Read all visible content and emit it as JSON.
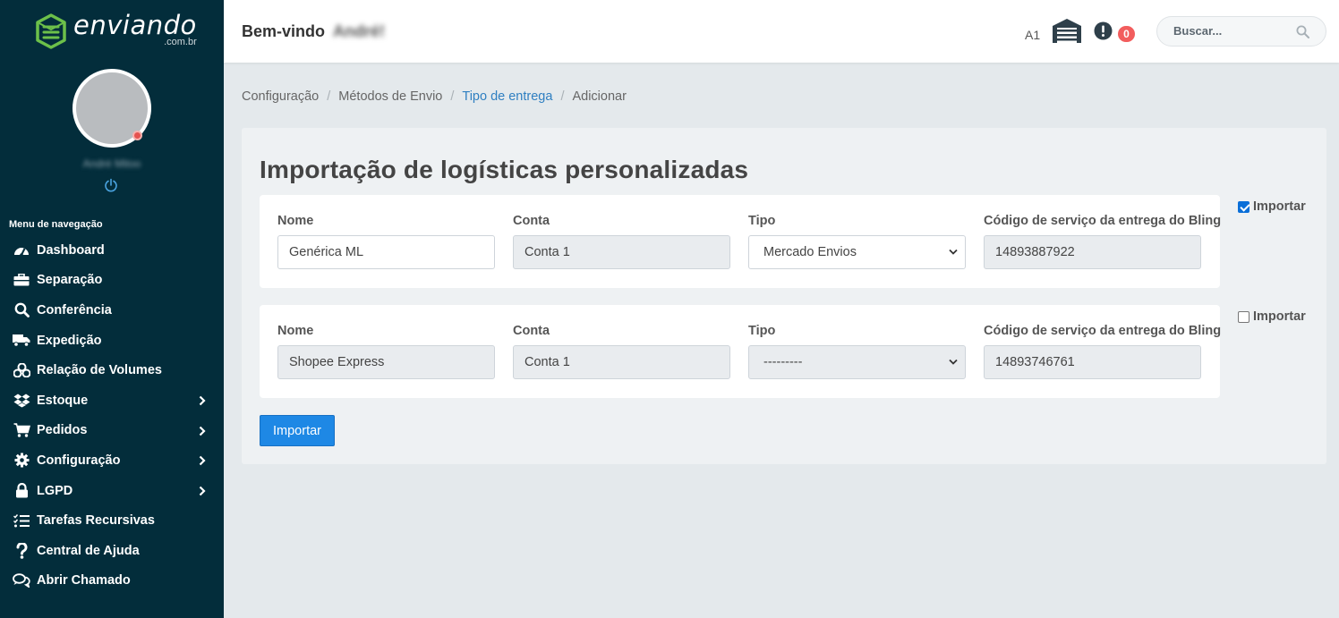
{
  "sidebar": {
    "logo": {
      "word": "enviando",
      "sub": ".com.br",
      "color": "#6cc04a"
    },
    "user_name": "André Mitoo",
    "menu_title": "Menu de navegação",
    "items": [
      {
        "label": "Dashboard",
        "icon": "tachometer-icon",
        "submenu": false
      },
      {
        "label": "Separação",
        "icon": "toolbox-icon",
        "submenu": false
      },
      {
        "label": "Conferência",
        "icon": "search-icon",
        "submenu": false
      },
      {
        "label": "Expedição",
        "icon": "truck-icon",
        "submenu": false
      },
      {
        "label": "Relação de Volumes",
        "icon": "cubes-icon",
        "submenu": false
      },
      {
        "label": "Estoque",
        "icon": "dropbox-icon",
        "submenu": true
      },
      {
        "label": "Pedidos",
        "icon": "cart-icon",
        "submenu": true
      },
      {
        "label": "Configuração",
        "icon": "gear-icon",
        "submenu": true
      },
      {
        "label": "LGPD",
        "icon": "lock-icon",
        "submenu": true
      },
      {
        "label": "Tarefas Recursivas",
        "icon": "tasks-icon",
        "submenu": false
      },
      {
        "label": "Central de Ajuda",
        "icon": "question-icon",
        "submenu": false
      },
      {
        "label": "Abrir Chamado",
        "icon": "chat-icon",
        "submenu": false
      }
    ]
  },
  "header": {
    "welcome": "Bem-vindo",
    "welcome_name": "André!",
    "warehouse_code": "A1",
    "notification_count": "0",
    "search_placeholder": "Buscar..."
  },
  "breadcrumb": {
    "items": [
      "Configuração",
      "Métodos de Envio",
      "Tipo de entrega",
      "Adicionar"
    ]
  },
  "card": {
    "title": "Importação de logísticas personalizadas",
    "labels": {
      "nome": "Nome",
      "conta": "Conta",
      "tipo": "Tipo",
      "codigo": "Código de serviço da entrega do Bling"
    },
    "rows": [
      {
        "nome": "Genérica ML",
        "conta": "Conta 1",
        "tipo": "Mercado Envios",
        "codigo": "14893887922",
        "importar": true,
        "import_label": "Importar"
      },
      {
        "nome": "Shopee Express",
        "conta": "Conta 1",
        "tipo": "---------",
        "codigo": "14893746761",
        "importar": false,
        "import_label": "Importar"
      }
    ],
    "submit_label": "Importar"
  }
}
